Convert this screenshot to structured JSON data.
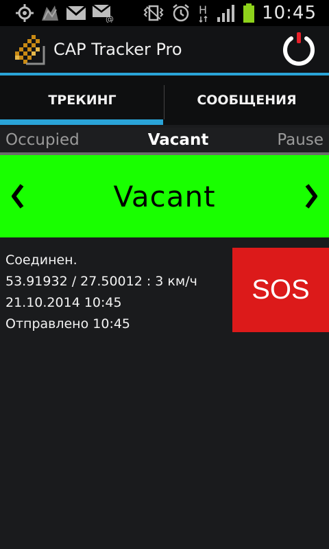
{
  "status_bar": {
    "time": "10:45",
    "net_indicator": "H",
    "icons": [
      "gps-icon",
      "app-notification-icon",
      "gmail-icon",
      "email-icon",
      "vibrate-icon",
      "alarm-icon",
      "network-h-icon",
      "signal-icon",
      "battery-icon"
    ],
    "battery_color": "#8ed21b"
  },
  "app_bar": {
    "title": "CAP Tracker Pro",
    "accent_color": "#2aa4d8",
    "power_red": "#e8202a"
  },
  "tabs": [
    {
      "label": "ТРЕКИНГ",
      "selected": true
    },
    {
      "label": "СООБЩЕНИЯ",
      "selected": false
    }
  ],
  "status_selector": {
    "left": "Occupied",
    "current": "Vacant",
    "right": "Pause"
  },
  "current_status": {
    "label": "Vacant",
    "color": "#19ff00"
  },
  "info": {
    "connection": "Соединен.",
    "location": "53.91932 / 27.50012 : 3 км/ч",
    "datetime": "21.10.2014 10:45",
    "sent": "Отправлено 10:45"
  },
  "sos": {
    "label": "SOS",
    "color": "#dc1a1a"
  }
}
